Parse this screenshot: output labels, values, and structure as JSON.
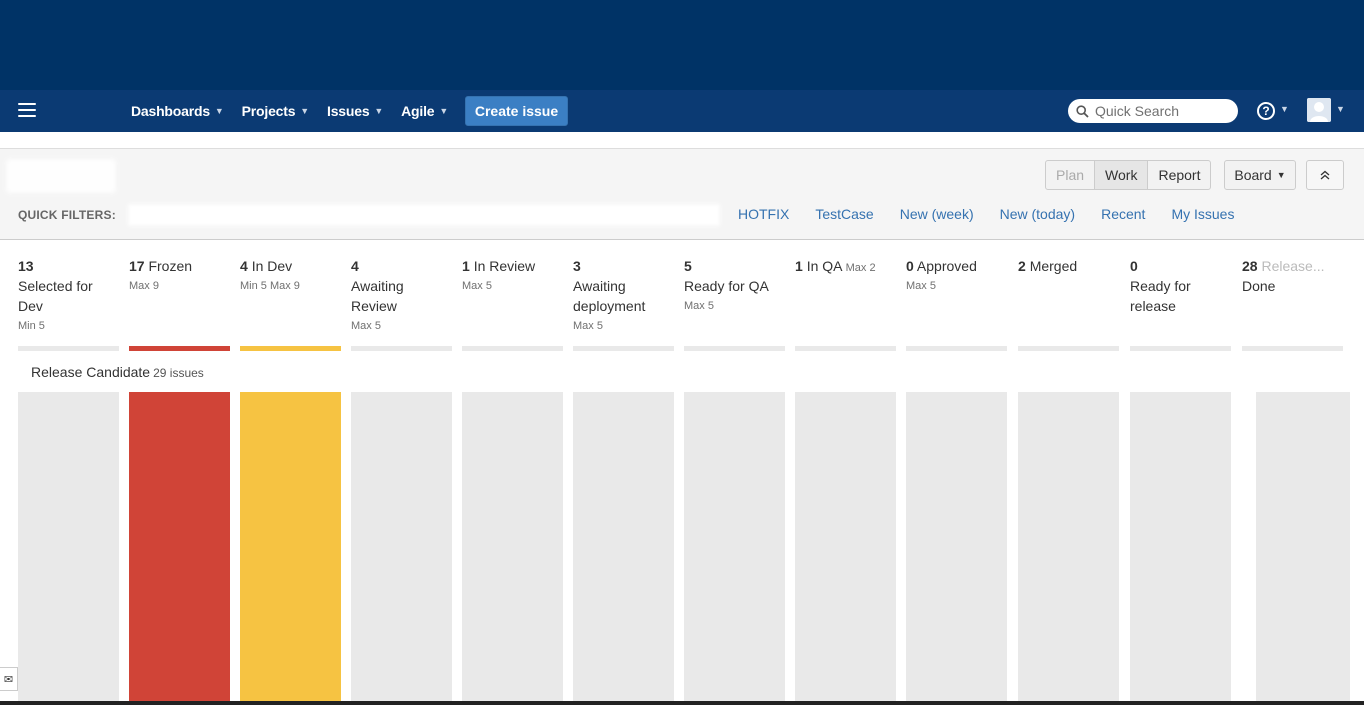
{
  "nav": {
    "items": [
      {
        "label": "Dashboards"
      },
      {
        "label": "Projects"
      },
      {
        "label": "Issues"
      },
      {
        "label": "Agile"
      }
    ],
    "create_label": "Create issue",
    "search_placeholder": "Quick Search",
    "help_icon": "question-circle-icon",
    "avatar_icon": "user-avatar-icon"
  },
  "toolbar": {
    "modes": [
      {
        "label": "Plan",
        "state": "disabled"
      },
      {
        "label": "Work",
        "state": "active"
      },
      {
        "label": "Report",
        "state": "normal"
      }
    ],
    "board_label": "Board",
    "collapse_icon": "double-chevron-up-icon"
  },
  "quick_filters": {
    "label": "QUICK FILTERS:",
    "links": [
      "HOTFIX",
      "TestCase",
      "New (week)",
      "New (today)",
      "Recent",
      "My Issues"
    ]
  },
  "columns": [
    {
      "count": "13",
      "name": "Selected for Dev",
      "limit": "Min 5",
      "status": "normal"
    },
    {
      "count": "17",
      "name": "Frozen",
      "limit": "Max 9",
      "status": "over"
    },
    {
      "count": "4",
      "name": "In Dev",
      "limit": "Min 5  Max 9",
      "status": "under"
    },
    {
      "count": "4",
      "name": "Awaiting Review",
      "limit": "Max 5",
      "status": "normal"
    },
    {
      "count": "1",
      "name": "In Review",
      "limit": "Max 5",
      "status": "normal"
    },
    {
      "count": "3",
      "name": "Awaiting deployment",
      "limit": "Max 5",
      "status": "normal"
    },
    {
      "count": "5",
      "name": "Ready for QA",
      "limit": "Max 5",
      "status": "normal"
    },
    {
      "count": "1",
      "name": "In QA",
      "limit": "Max 2",
      "status": "normal"
    },
    {
      "count": "0",
      "name": "Approved",
      "limit": "Max 5",
      "status": "normal"
    },
    {
      "count": "2",
      "name": "Merged",
      "limit": "",
      "status": "normal"
    },
    {
      "count": "0",
      "name": "Ready for release",
      "limit": "",
      "status": "normal"
    },
    {
      "count": "28",
      "name": "Done",
      "extra": "Release...",
      "limit": "",
      "status": "normal"
    }
  ],
  "swimlane": {
    "title": "Release Candidate",
    "count_text": "29 issues"
  },
  "colors": {
    "top_band": "#003366",
    "navbar": "#0b3a73",
    "create_button": "#3b7fc4",
    "link": "#3572b0",
    "over_limit": "#d04437",
    "under_limit": "#f6c342",
    "column_bg": "#e9e9e9"
  },
  "feedback_icon": "envelope-icon"
}
